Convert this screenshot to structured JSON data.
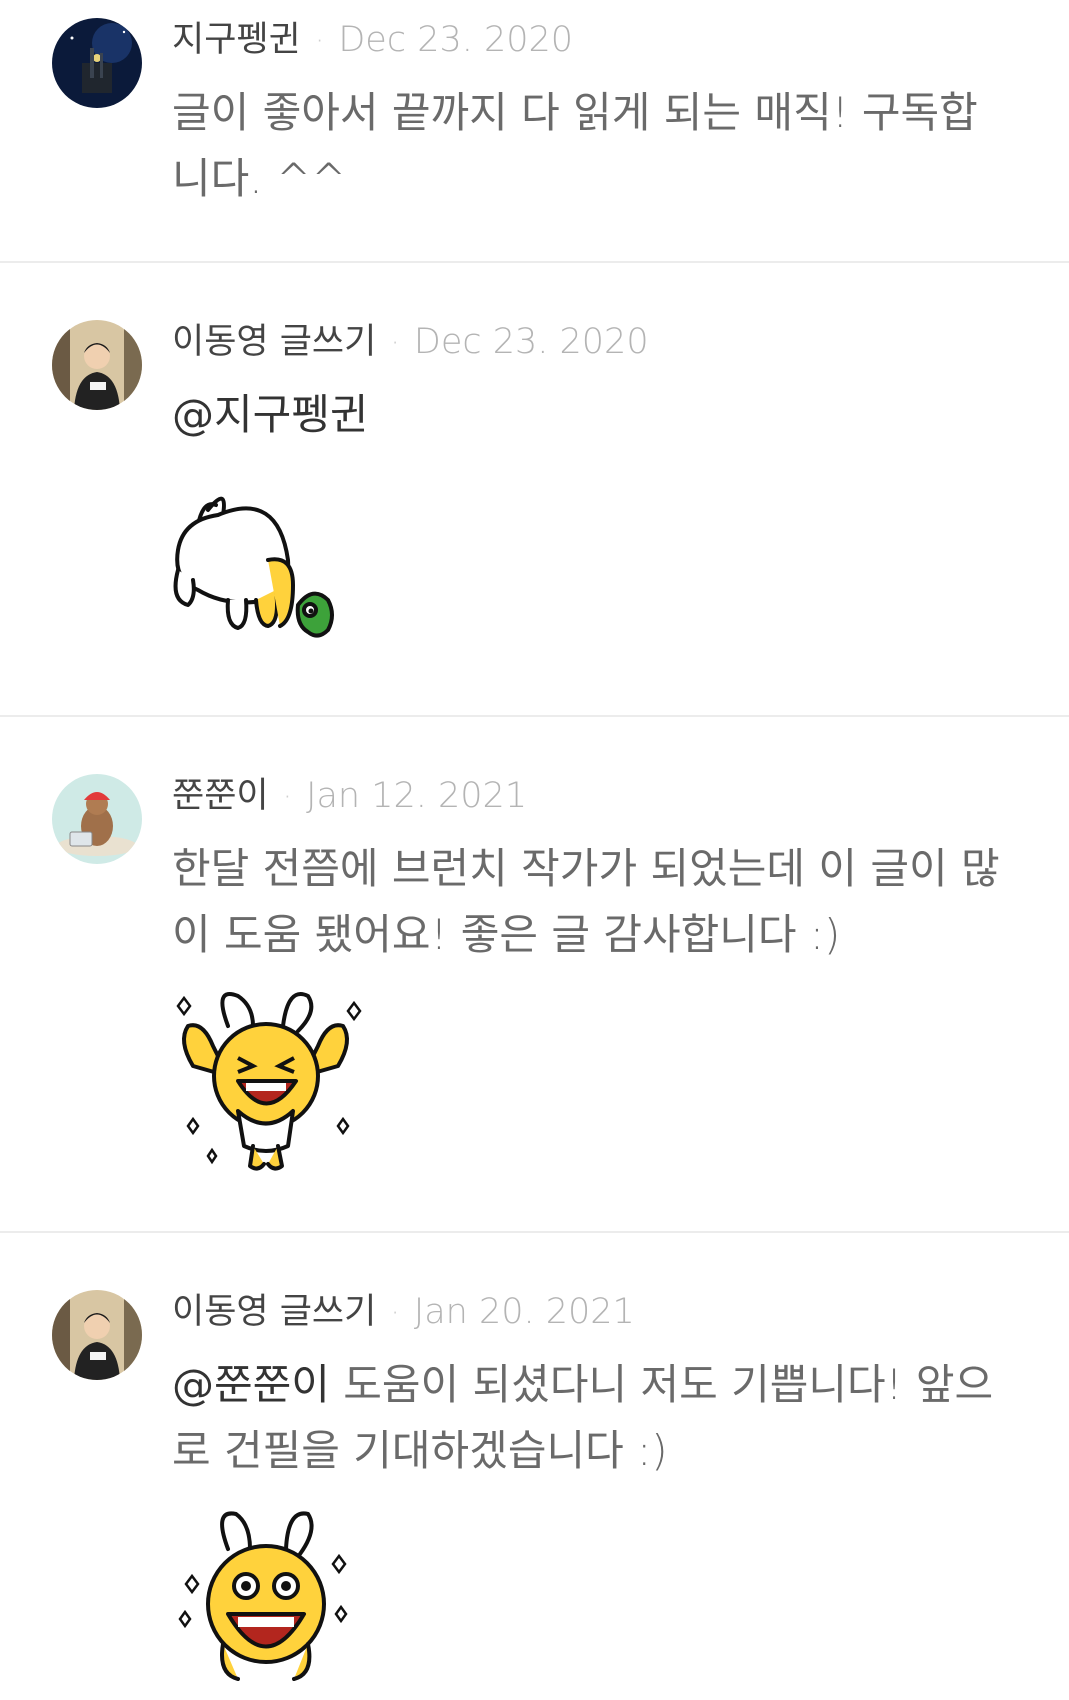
{
  "comments": [
    {
      "author": "지구펭귄",
      "date": "Dec 23. 2020",
      "text_line1": "글이 좋아서 끝까지 다 읽게 되는 매직! 구독합",
      "text_line2": "니다. ^^"
    },
    {
      "author": "이동영 글쓰기",
      "date": "Dec 23. 2020",
      "mention": "@지구펭귄"
    },
    {
      "author": "쭌쭌이",
      "date": "Jan 12. 2021",
      "text_line1": "한달 전쯤에 브런치 작가가 되었는데 이 글이 많",
      "text_line2": "이 도움 됐어요! 좋은 글 감사합니다 :)"
    },
    {
      "author": "이동영 글쓰기",
      "date": "Jan 20. 2021",
      "mention": "@쭌쭌이",
      "text_line1_rest": " 도움이 되셨다니 저도 기쁩니다! 앞으",
      "text_line2": "로 건필을 기대하겠습니다 :)"
    }
  ],
  "separator": "·"
}
